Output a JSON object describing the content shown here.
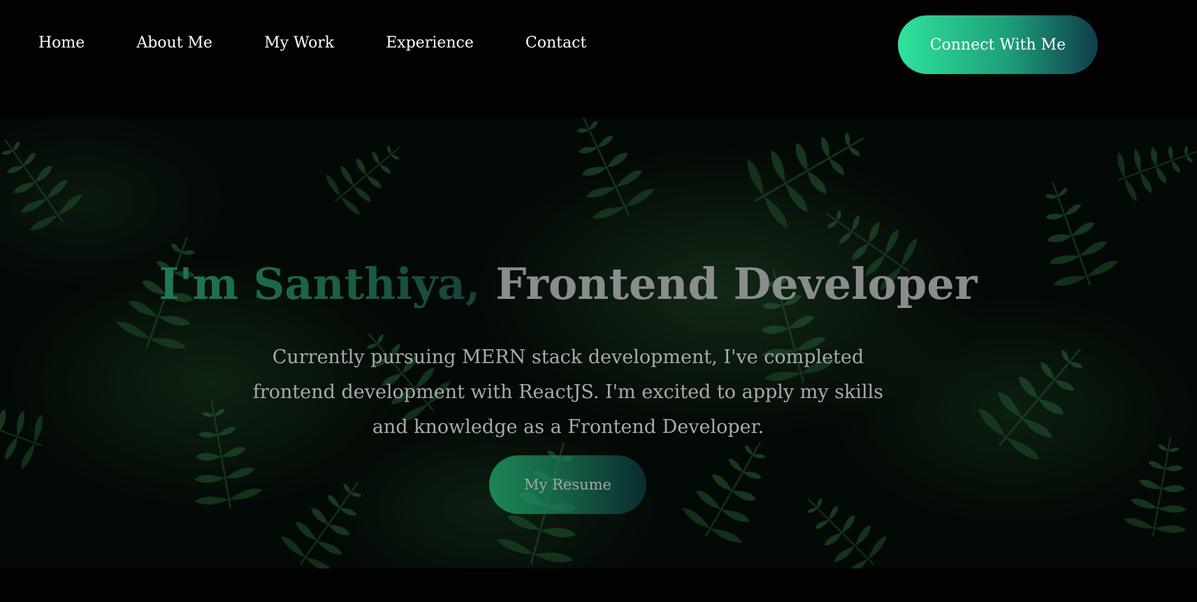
{
  "nav": {
    "items": [
      {
        "label": "Home"
      },
      {
        "label": "About Me"
      },
      {
        "label": "My Work"
      },
      {
        "label": "Experience"
      },
      {
        "label": "Contact"
      }
    ],
    "connect_label": "Connect With Me"
  },
  "hero": {
    "title_name": "I'm Santhiya, ",
    "title_role": "Frontend Developer",
    "description": "Currently pursuing MERN stack development, I've completed frontend development with ReactJS. I'm excited to apply my skills and knowledge as a Frontend Developer.",
    "resume_label": "My Resume",
    "background_image": "dark-fern-leaves"
  },
  "colors": {
    "background": "#020202",
    "accent_start": "#2fe39b",
    "accent_end": "#0f3d4a",
    "nav_text": "#ffffff",
    "title_role": "#8a8d8b",
    "description_text": "#a8aba9"
  }
}
